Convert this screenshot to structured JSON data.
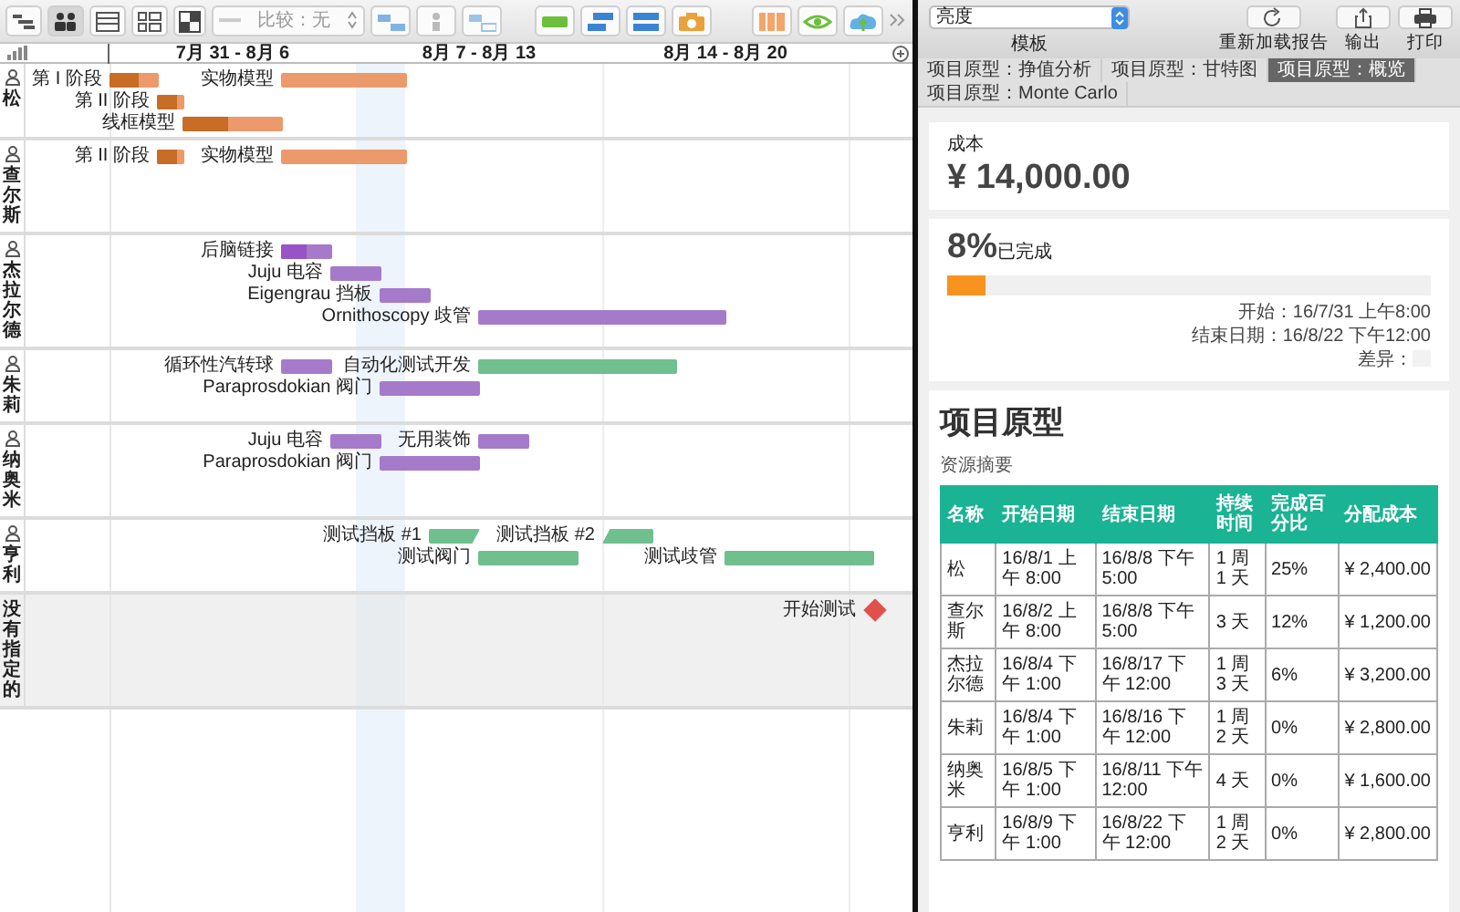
{
  "toolbar": {
    "views": [
      {
        "selected": false
      },
      {
        "selected": true
      },
      {
        "selected": false
      },
      {
        "selected": false
      }
    ],
    "comparison": "比较：无"
  },
  "timeline": {
    "weeks": [
      "7月 31 - 8月 6",
      "8月 7 - 8月 13",
      "8月 14 - 8月 20"
    ]
  },
  "lanes": [
    {
      "name": "松",
      "person": true,
      "tasks": [
        {
          "kind": "bar",
          "label": "第 I 阶段",
          "color": "#ec9a6c",
          "level": 0.6
        },
        {
          "kind": "bar",
          "label": "实物模型",
          "color": "#ec9a6c"
        },
        {
          "kind": "bar",
          "label": "第 II 阶段",
          "color": "#ec9a6c",
          "level": 0.7
        },
        {
          "kind": "bar",
          "label": "线框模型",
          "color": "#ec9a6c",
          "level": 0.45
        }
      ]
    },
    {
      "name": "查尔斯",
      "person": true,
      "tasks": [
        {
          "kind": "bar",
          "label": "第 II 阶段",
          "color": "#ec9a6c",
          "level": 0.7
        },
        {
          "kind": "bar",
          "label": "实物模型",
          "color": "#ec9a6c"
        }
      ]
    },
    {
      "name": "杰拉尔德",
      "person": true,
      "tasks": [
        {
          "kind": "bar",
          "label": "后脑链接",
          "color": "#a67acb",
          "level": 0.5
        },
        {
          "kind": "bar",
          "label": "Juju 电容",
          "color": "#a67acb"
        },
        {
          "kind": "bar",
          "label": "Eigengrau 挡板",
          "color": "#a67acb"
        },
        {
          "kind": "bar",
          "label": "Ornithoscopy 歧管",
          "color": "#a67acb"
        }
      ]
    },
    {
      "name": "朱莉",
      "person": true,
      "tasks": [
        {
          "kind": "bar",
          "label": "循环性汽转球",
          "color": "#a67acb"
        },
        {
          "kind": "bar",
          "label": "自动化测试开发",
          "color": "#6fbf8f"
        },
        {
          "kind": "bar",
          "label": "Paraprosdokian 阀门",
          "color": "#a67acb"
        }
      ]
    },
    {
      "name": "纳奥米",
      "person": true,
      "tasks": [
        {
          "kind": "bar",
          "label": "Juju 电容",
          "color": "#a67acb"
        },
        {
          "kind": "bar",
          "label": "无用装饰",
          "color": "#a67acb"
        },
        {
          "kind": "bar",
          "label": "Paraprosdokian 阀门",
          "color": "#a67acb"
        }
      ]
    },
    {
      "name": "亨利",
      "person": true,
      "tasks": [
        {
          "kind": "slant-end",
          "label": "测试挡板 #1",
          "color": "#6fbf8f"
        },
        {
          "kind": "slant-start",
          "label": "测试挡板 #2",
          "color": "#6fbf8f"
        },
        {
          "kind": "bar",
          "label": "测试阀门",
          "color": "#6fbf8f"
        },
        {
          "kind": "bar",
          "label": "测试歧管",
          "color": "#6fbf8f"
        }
      ]
    },
    {
      "name": "没有指定的",
      "person": false,
      "tasks": [
        {
          "kind": "milestone",
          "label": "开始测试",
          "color": "#e0514b"
        }
      ]
    }
  ],
  "report": {
    "template": {
      "value": "亮度",
      "label": "模板"
    },
    "buttons": [
      {
        "kind": "reload",
        "label": "重新加载报告"
      },
      {
        "kind": "export",
        "label": "输出"
      },
      {
        "kind": "print",
        "label": "打印"
      }
    ],
    "tabs": [
      {
        "label": "项目原型：挣值分析",
        "selected": false
      },
      {
        "label": "项目原型：甘特图",
        "selected": false
      },
      {
        "label": "项目原型：概览",
        "selected": true
      },
      {
        "label": "项目原型：Monte Carlo",
        "selected": false
      }
    ],
    "cost": {
      "label": "成本",
      "value": "¥ 14,000.00"
    },
    "progress": {
      "percent": "8%",
      "caption": "已完成",
      "level": 0.08,
      "start": "开始：16/7/31 上午8:00",
      "end": "结束日期：16/8/22 下午12:00",
      "variance": "差异："
    },
    "title": "项目原型",
    "summary": {
      "title": "资源摘要",
      "columns": [
        "名称",
        "开始日期",
        "结束日期",
        "持续时间",
        "完成百分比",
        "分配成本"
      ],
      "rows": [
        [
          "松",
          "16/8/1 上午 8:00",
          "16/8/8 下午5:00",
          "1 周 1 天",
          "25%",
          "¥ 2,400.00"
        ],
        [
          "查尔斯",
          "16/8/2 上午 8:00",
          "16/8/8 下午5:00",
          "3 天",
          "12%",
          "¥ 1,200.00"
        ],
        [
          "杰拉尔德",
          "16/8/4 下午 1:00",
          "16/8/17 下午 12:00",
          "1 周 3 天",
          "6%",
          "¥ 3,200.00"
        ],
        [
          "朱莉",
          "16/8/4 下午 1:00",
          "16/8/16 下午 12:00",
          "1 周 2 天",
          "0%",
          "¥ 2,800.00"
        ],
        [
          "纳奥米",
          "16/8/5 下午 1:00",
          "16/8/11 下午 12:00",
          "4 天",
          "0%",
          "¥ 1,600.00"
        ],
        [
          "亨利",
          "16/8/9 下午 1:00",
          "16/8/22 下午 12:00",
          "1 周 2 天",
          "0%",
          "¥ 2,800.00"
        ]
      ]
    }
  }
}
